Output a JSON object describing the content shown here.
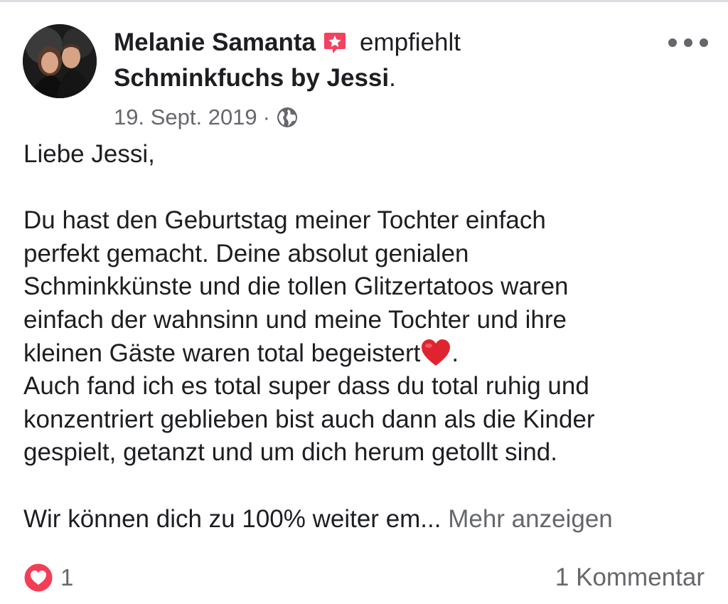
{
  "post": {
    "author": "Melanie Samanta",
    "recommends_label": "empfiehlt",
    "page_name": "Schminkfuchs by Jessi",
    "page_suffix": ".",
    "date": "19. Sept. 2019",
    "separator": "·",
    "privacy_icon": "globe-icon",
    "badge_icon": "recommendation-star-icon",
    "more_icon": "ellipsis-icon"
  },
  "body": {
    "greeting": "Liebe Jessi,",
    "lines": [
      "Du hast den Geburtstag meiner Tochter einfach",
      "perfekt gemacht. Deine absolut genialen",
      "Schminkkünste und die tollen Glitzertatoos waren",
      "einfach der wahnsinn und meine Tochter und ihre",
      "kleinen Gäste waren total begeistert"
    ],
    "heart_emoji_suffix": ".",
    "lines2": [
      "Auch fand ich es total super dass du total ruhig und",
      "konzentriert geblieben bist auch dann als die Kinder",
      "gespielt, getanzt und um dich herum getollt sind."
    ],
    "truncated_line": "Wir können dich zu 100% weiter em...",
    "see_more_label": "Mehr anzeigen"
  },
  "footer": {
    "reaction_icon": "love-reaction-icon",
    "reaction_count": "1",
    "comments_label": "1 Kommentar"
  },
  "colors": {
    "text": "#1c1e21",
    "secondary": "#65676b",
    "badge": "#f3425f",
    "love": "#f33e58",
    "heart_emoji": "#e0242f"
  }
}
